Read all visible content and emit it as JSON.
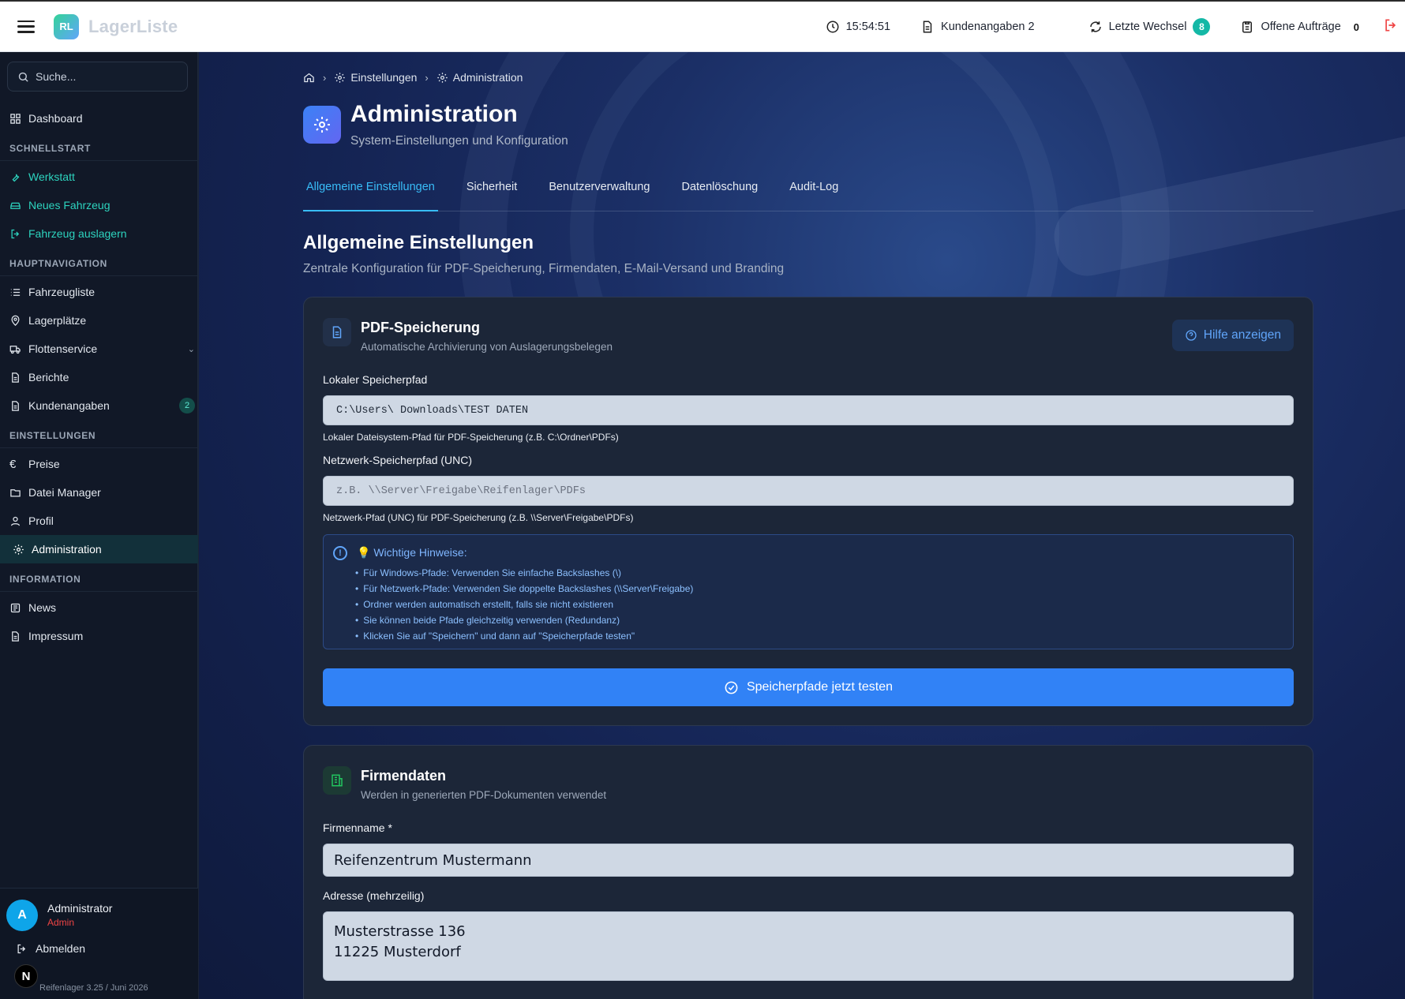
{
  "topbar": {
    "logo_initials": "RL",
    "app_name": "LagerListe",
    "time": "15:54:51",
    "customer_info_label": "Kundenangaben 2",
    "recent_changes_label": "Letzte Wechsel",
    "recent_changes_count": "8",
    "open_orders_label": "Offene Aufträge",
    "open_orders_count": "0"
  },
  "sidebar": {
    "search_placeholder": "Suche...",
    "dashboard": "Dashboard",
    "section_quickstart": "SCHNELLSTART",
    "quick": [
      "Werkstatt",
      "Neues Fahrzeug",
      "Fahrzeug auslagern"
    ],
    "section_main": "HAUPTNAVIGATION",
    "main": [
      "Fahrzeugliste",
      "Lagerplätze",
      "Flottenservice",
      "Berichte",
      "Kundenangaben"
    ],
    "kundenangaben_badge": "2",
    "section_settings": "EINSTELLUNGEN",
    "settings": [
      "Preise",
      "Datei Manager",
      "Profil",
      "Administration"
    ],
    "section_info": "INFORMATION",
    "info": [
      "News",
      "Impressum"
    ],
    "user": {
      "initial": "A",
      "name": "Administrator",
      "role": "Admin",
      "logout": "Abmelden"
    },
    "n_badge": "N",
    "version": "Reifenlager 3.25 / Juni 2026"
  },
  "breadcrumb": {
    "level1": "Einstellungen",
    "level2": "Administration"
  },
  "page": {
    "title": "Administration",
    "subtitle": "System-Einstellungen und Konfiguration"
  },
  "tabs": [
    "Allgemeine Einstellungen",
    "Sicherheit",
    "Benutzerverwaltung",
    "Datenlöschung",
    "Audit-Log"
  ],
  "section": {
    "title": "Allgemeine Einstellungen",
    "subtitle": "Zentrale Konfiguration für PDF-Speicherung, Firmendaten, E-Mail-Versand und Branding"
  },
  "pdf_card": {
    "title": "PDF-Speicherung",
    "subtitle": "Automatische Archivierung von Auslagerungsbelegen",
    "help_button": "Hilfe anzeigen",
    "local_label": "Lokaler Speicherpfad",
    "local_value": "C:\\Users\\         Downloads\\TEST DATEN",
    "local_hint": "Lokaler Dateisystem-Pfad für PDF-Speicherung (z.B. C:\\Ordner\\PDFs)",
    "network_label": "Netzwerk-Speicherpfad (UNC)",
    "network_placeholder": "z.B. \\\\Server\\Freigabe\\Reifenlager\\PDFs",
    "network_hint": "Netzwerk-Pfad (UNC) für PDF-Speicherung (z.B. \\\\Server\\Freigabe\\PDFs)",
    "notes_title": "💡 Wichtige Hinweise:",
    "notes": [
      "Für Windows-Pfade: Verwenden Sie einfache Backslashes (\\)",
      "Für Netzwerk-Pfade: Verwenden Sie doppelte Backslashes (\\\\Server\\Freigabe)",
      "Ordner werden automatisch erstellt, falls sie nicht existieren",
      "Sie können beide Pfade gleichzeitig verwenden (Redundanz)",
      "Klicken Sie auf \"Speichern\" und dann auf \"Speicherpfade testen\""
    ],
    "test_button": "Speicherpfade jetzt testen"
  },
  "company_card": {
    "title": "Firmendaten",
    "subtitle": "Werden in generierten PDF-Dokumenten verwendet",
    "name_label": "Firmenname *",
    "name_value": "Reifenzentrum Mustermann",
    "address_label": "Adresse (mehrzeilig)",
    "address_value": "Musterstrasse 136\n11225 Musterdorf"
  },
  "colors": {
    "accent_teal": "#14b8a6",
    "primary_blue": "#3182f6",
    "sidebar_bg": "#111827",
    "logout_red": "#ef4444"
  }
}
